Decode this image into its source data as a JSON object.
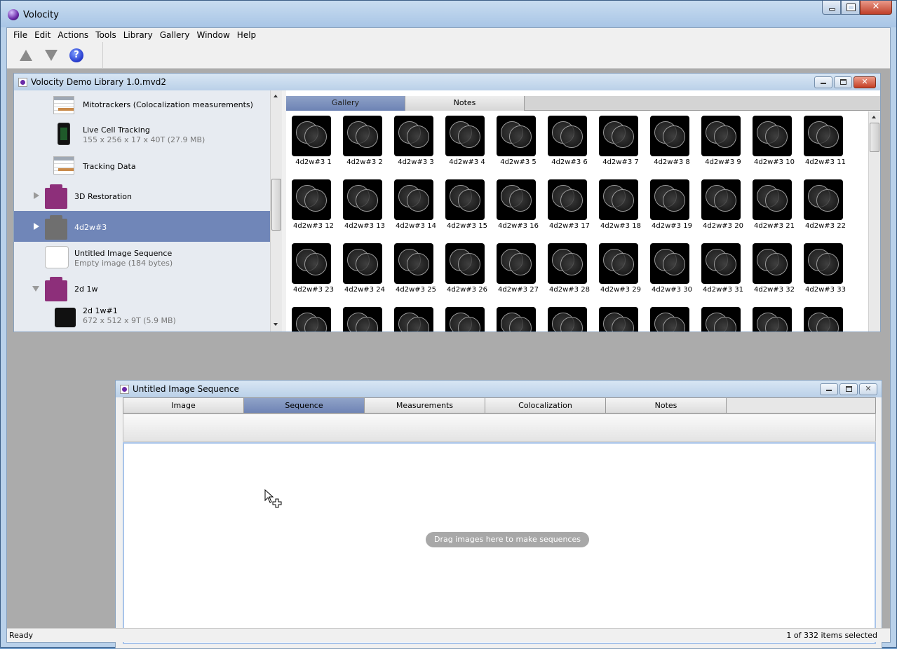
{
  "app": {
    "title": "Volocity"
  },
  "menu": [
    "File",
    "Edit",
    "Actions",
    "Tools",
    "Library",
    "Gallery",
    "Window",
    "Help"
  ],
  "toolbar": {
    "up_icon": "up-arrow-icon",
    "down_icon": "down-arrow-icon",
    "help_label": "?"
  },
  "library": {
    "title": "Volocity Demo Library 1.0.mvd2",
    "items": [
      {
        "label": "Mitotrackers (Colocalization measurements)",
        "sub": "",
        "icon": "table-icon"
      },
      {
        "label": "Live Cell Tracking",
        "sub": "155 x 256 x 17 x 40T (27.9 MB)",
        "icon": "phone-icon"
      },
      {
        "label": "Tracking Data",
        "sub": "",
        "icon": "table-icon"
      },
      {
        "label": "3D Restoration",
        "sub": "",
        "icon": "folder-icon"
      },
      {
        "label": "4d2w#3",
        "sub": "",
        "icon": "folder-icon",
        "selected": true
      },
      {
        "label": "Untitled Image Sequence",
        "sub": "Empty image (184 bytes)",
        "icon": "blank-image-icon"
      },
      {
        "label": "2d 1w",
        "sub": "",
        "icon": "folder-icon"
      },
      {
        "label": "2d 1w#1",
        "sub": "672 x 512 x 9T (5.9 MB)",
        "icon": "image-thumbnail-icon"
      }
    ],
    "tabs": [
      "Gallery",
      "Notes"
    ],
    "thumbnails": [
      "4d2w#3 1",
      "4d2w#3 2",
      "4d2w#3 3",
      "4d2w#3 4",
      "4d2w#3 5",
      "4d2w#3 6",
      "4d2w#3 7",
      "4d2w#3 8",
      "4d2w#3 9",
      "4d2w#3 10",
      "4d2w#3 11",
      "4d2w#3 12",
      "4d2w#3 13",
      "4d2w#3 14",
      "4d2w#3 15",
      "4d2w#3 16",
      "4d2w#3 17",
      "4d2w#3 18",
      "4d2w#3 19",
      "4d2w#3 20",
      "4d2w#3 21",
      "4d2w#3 22",
      "4d2w#3 23",
      "4d2w#3 24",
      "4d2w#3 25",
      "4d2w#3 26",
      "4d2w#3 27",
      "4d2w#3 28",
      "4d2w#3 29",
      "4d2w#3 30",
      "4d2w#3 31",
      "4d2w#3 32",
      "4d2w#3 33",
      "",
      "",
      "",
      "",
      "",
      "",
      "",
      "",
      "",
      "",
      ""
    ]
  },
  "sequence": {
    "title": "Untitled Image Sequence",
    "tabs": [
      "Image",
      "Sequence",
      "Measurements",
      "Colocalization",
      "Notes"
    ],
    "active_tab": "Sequence",
    "drop_hint": "Drag images here to make sequences"
  },
  "status": {
    "left": "Ready",
    "right": "1 of 332 items selected"
  },
  "colors": {
    "selection": "#7086b8",
    "folder_purple": "#8d2f7a",
    "folder_gray": "#6f6f6f",
    "tab_active": "#6d83b4"
  }
}
